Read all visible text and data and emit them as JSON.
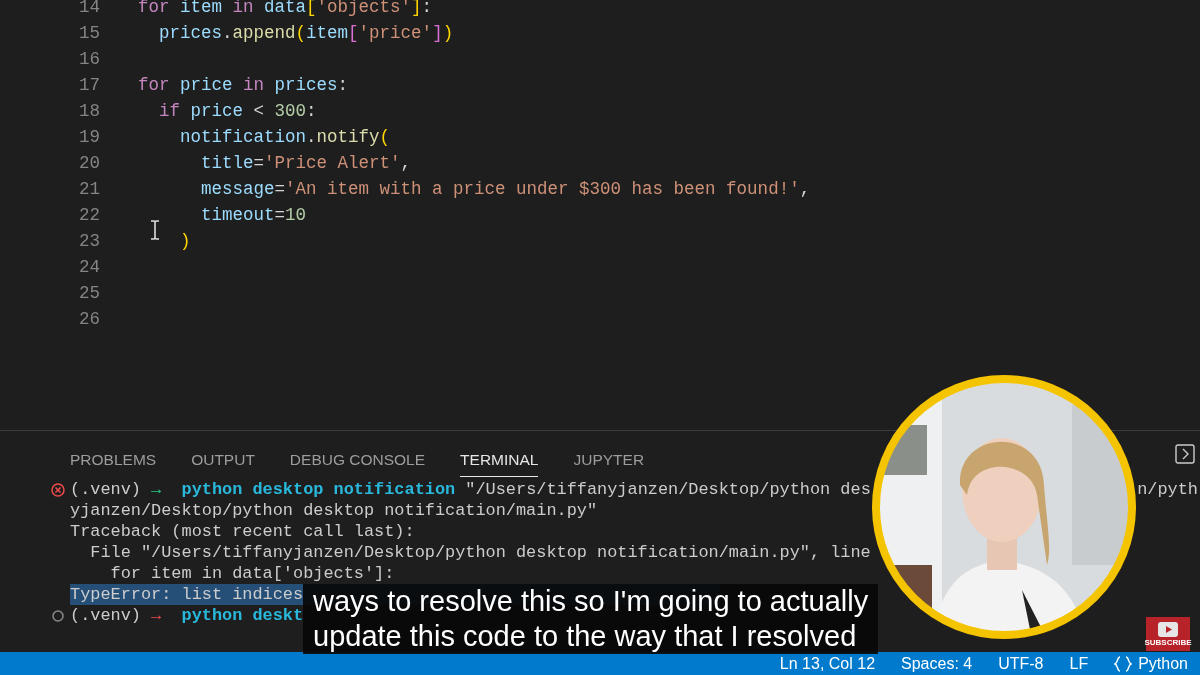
{
  "editor": {
    "lines": [
      {
        "number": "14",
        "tokens": [
          {
            "text": "for",
            "kind": "kw"
          },
          {
            "text": " item ",
            "kind": "var"
          },
          {
            "text": "in",
            "kind": "kw"
          },
          {
            "text": " data",
            "kind": "var"
          },
          {
            "text": "[",
            "kind": "br1"
          },
          {
            "text": "'objects'",
            "kind": "str"
          },
          {
            "text": "]",
            "kind": "br1"
          },
          {
            "text": ":",
            "kind": "op"
          }
        ]
      },
      {
        "number": "15",
        "tokens": [
          {
            "text": "  prices",
            "kind": "var"
          },
          {
            "text": ".",
            "kind": "op"
          },
          {
            "text": "append",
            "kind": "fn"
          },
          {
            "text": "(",
            "kind": "br1"
          },
          {
            "text": "item",
            "kind": "var"
          },
          {
            "text": "[",
            "kind": "br2"
          },
          {
            "text": "'price'",
            "kind": "str"
          },
          {
            "text": "]",
            "kind": "br2"
          },
          {
            "text": ")",
            "kind": "br1"
          }
        ]
      },
      {
        "number": "16"
      },
      {
        "number": "17",
        "tokens": [
          {
            "text": "for",
            "kind": "kw"
          },
          {
            "text": " price ",
            "kind": "var"
          },
          {
            "text": "in",
            "kind": "kw"
          },
          {
            "text": " prices",
            "kind": "var"
          },
          {
            "text": ":",
            "kind": "op"
          }
        ]
      },
      {
        "number": "18",
        "tokens": [
          {
            "text": "  if",
            "kind": "kw"
          },
          {
            "text": " price ",
            "kind": "var"
          },
          {
            "text": "<",
            "kind": "op"
          },
          {
            "text": " 300",
            "kind": "num"
          },
          {
            "text": ":",
            "kind": "op"
          }
        ]
      },
      {
        "number": "19",
        "tokens": [
          {
            "text": "    notification",
            "kind": "var"
          },
          {
            "text": ".",
            "kind": "op"
          },
          {
            "text": "notify",
            "kind": "fn"
          },
          {
            "text": "(",
            "kind": "br1"
          }
        ]
      },
      {
        "number": "20",
        "tokens": [
          {
            "text": "      title",
            "kind": "var"
          },
          {
            "text": "=",
            "kind": "op"
          },
          {
            "text": "'Price Alert'",
            "kind": "str"
          },
          {
            "text": ",",
            "kind": "op"
          }
        ]
      },
      {
        "number": "21",
        "tokens": [
          {
            "text": "      message",
            "kind": "var"
          },
          {
            "text": "=",
            "kind": "op"
          },
          {
            "text": "'An item with a price under $300 has been found!'",
            "kind": "str"
          },
          {
            "text": ",",
            "kind": "op"
          }
        ]
      },
      {
        "number": "22",
        "tokens": [
          {
            "text": "      timeout",
            "kind": "var"
          },
          {
            "text": "=",
            "kind": "op"
          },
          {
            "text": "10",
            "kind": "num"
          }
        ]
      },
      {
        "number": "23",
        "tokens": [
          {
            "text": "    )",
            "kind": "br1"
          }
        ]
      },
      {
        "number": "24"
      },
      {
        "number": "25"
      },
      {
        "number": "26"
      }
    ]
  },
  "panel": {
    "tabs": [
      {
        "label": "PROBLEMS",
        "selected": false
      },
      {
        "label": "OUTPUT",
        "selected": false
      },
      {
        "label": "DEBUG CONSOLE",
        "selected": false
      },
      {
        "label": "TERMINAL",
        "selected": true
      },
      {
        "label": "JUPYTER",
        "selected": false
      }
    ],
    "terminal": {
      "lines": [
        {
          "kind": "error_prompt",
          "highlighted": false,
          "tokens": [
            {
              "text": "(.venv) ",
              "kind": "plain"
            },
            {
              "text": "→",
              "kind": "arrow_ok"
            },
            {
              "text": "  python desktop notification",
              "kind": "cmd"
            },
            {
              "text": " \"/Users/tiffanyjanzen/Desktop/python des",
              "kind": "plain"
            }
          ],
          "right_text": "n/pyth"
        },
        {
          "kind": "output",
          "highlighted": false,
          "tokens": [
            {
              "text": "yjanzen/Desktop/python desktop notification/main.py\"",
              "kind": "plain"
            }
          ]
        },
        {
          "kind": "output",
          "highlighted": false,
          "tokens": [
            {
              "text": "Traceback (most recent call last):",
              "kind": "plain"
            }
          ]
        },
        {
          "kind": "output",
          "highlighted": false,
          "tokens": [
            {
              "text": "  File \"/Users/tiffanyjanzen/Desktop/python desktop notification/main.py\", line",
              "kind": "plain"
            }
          ]
        },
        {
          "kind": "output",
          "highlighted": false,
          "tokens": [
            {
              "text": "    for item in data['objects']:",
              "kind": "plain"
            }
          ]
        },
        {
          "kind": "output",
          "highlighted": true,
          "tokens": [
            {
              "text": "TypeError: list indices",
              "kind": "plain"
            }
          ]
        },
        {
          "kind": "idle_prompt",
          "highlighted": false,
          "tokens": [
            {
              "text": "(.venv) ",
              "kind": "plain"
            },
            {
              "text": "→",
              "kind": "arrow_fail"
            },
            {
              "text": "  python deskt",
              "kind": "cmd"
            }
          ]
        }
      ]
    }
  },
  "subtitles": [
    "ways to resolve this so I'm going to actually",
    "update this code to the way that I resolved"
  ],
  "status_bar": {
    "items": [
      {
        "text": "Ln 13, Col 12",
        "kind": "plain"
      },
      {
        "text": "Spaces: 4",
        "kind": "plain"
      },
      {
        "text": "UTF-8",
        "kind": "plain"
      },
      {
        "text": "LF",
        "kind": "plain"
      },
      {
        "text": "Python",
        "kind": "language"
      }
    ]
  },
  "subscribe_badge": {
    "label": "SUBSCRIBE"
  }
}
